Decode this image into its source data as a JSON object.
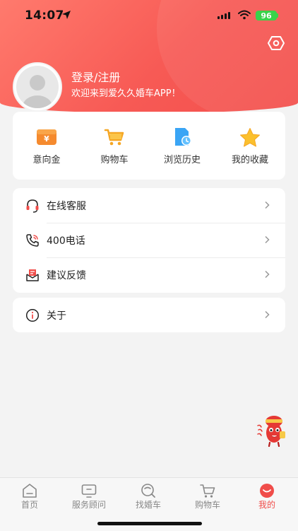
{
  "status_bar": {
    "time": "14:07",
    "battery": "96"
  },
  "profile": {
    "login_label": "登录/注册",
    "welcome_text": "欢迎来到爱久久婚车APP！"
  },
  "quick_actions": [
    {
      "label": "意向金",
      "icon": "deposit-icon"
    },
    {
      "label": "购物车",
      "icon": "shopping-cart-icon"
    },
    {
      "label": "浏览历史",
      "icon": "history-icon"
    },
    {
      "label": "我的收藏",
      "icon": "star-icon"
    }
  ],
  "menu": [
    {
      "label": "在线客服",
      "icon": "headset-icon"
    },
    {
      "label": "400电话",
      "icon": "phone-icon"
    },
    {
      "label": "建议反馈",
      "icon": "feedback-icon"
    }
  ],
  "about": {
    "label": "关于",
    "icon": "info-icon"
  },
  "tabbar": [
    {
      "label": "首页",
      "icon": "home-icon",
      "active": false
    },
    {
      "label": "服务顾问",
      "icon": "advisor-icon",
      "active": false
    },
    {
      "label": "找婚车",
      "icon": "search-car-icon",
      "active": false
    },
    {
      "label": "购物车",
      "icon": "cart-tab-icon",
      "active": false
    },
    {
      "label": "我的",
      "icon": "profile-tab-icon",
      "active": true
    }
  ],
  "colors": {
    "accent": "#f04d4a",
    "header_start": "#ff7a6d",
    "header_end": "#f34f4c"
  }
}
